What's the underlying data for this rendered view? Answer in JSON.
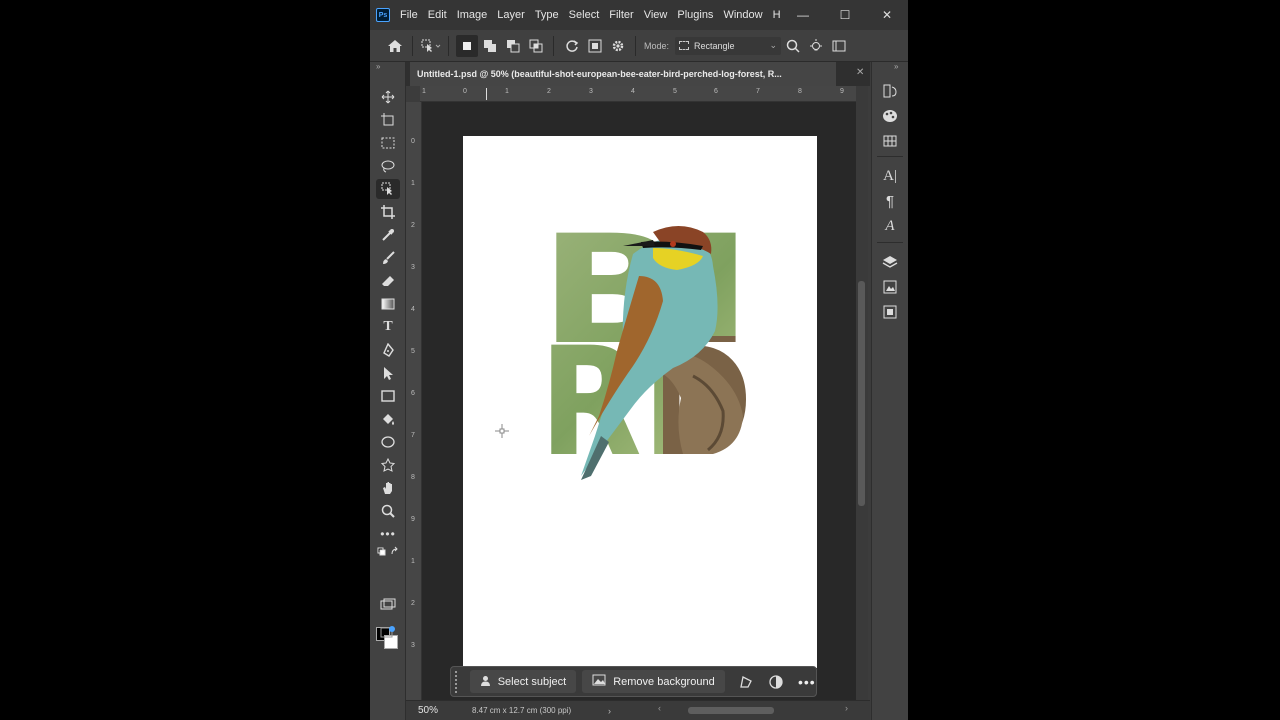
{
  "app": {
    "logo_text": "Ps"
  },
  "menu": [
    "File",
    "Edit",
    "Image",
    "Layer",
    "Type",
    "Select",
    "Filter",
    "View",
    "Plugins",
    "Window",
    "H"
  ],
  "window_controls": {
    "minimize": "—",
    "maximize": "☐",
    "close": "✕"
  },
  "options_bar": {
    "mode_label": "Mode:",
    "mode_value": "Rectangle"
  },
  "document": {
    "tab_title": "Untitled-1.psd @ 50% (beautiful-shot-european-bee-eater-bird-perched-log-forest, R...",
    "artwork_text": "BIRD"
  },
  "rulers": {
    "horizontal": [
      "1",
      "0",
      "1",
      "2",
      "3",
      "4",
      "5",
      "6",
      "7",
      "8",
      "9"
    ],
    "vertical": [
      "0",
      "1",
      "2",
      "3",
      "4",
      "5",
      "6",
      "7",
      "8",
      "9",
      "1",
      "2",
      "3"
    ]
  },
  "context_bar": {
    "select_subject": "Select subject",
    "remove_background": "Remove background"
  },
  "status": {
    "zoom": "50%",
    "doc_info": "8.47 cm x 12.7 cm (300 ppi)"
  },
  "colors": {
    "bird_fill_green": "#8da96b",
    "accent_blue": "#4aa3ff"
  }
}
